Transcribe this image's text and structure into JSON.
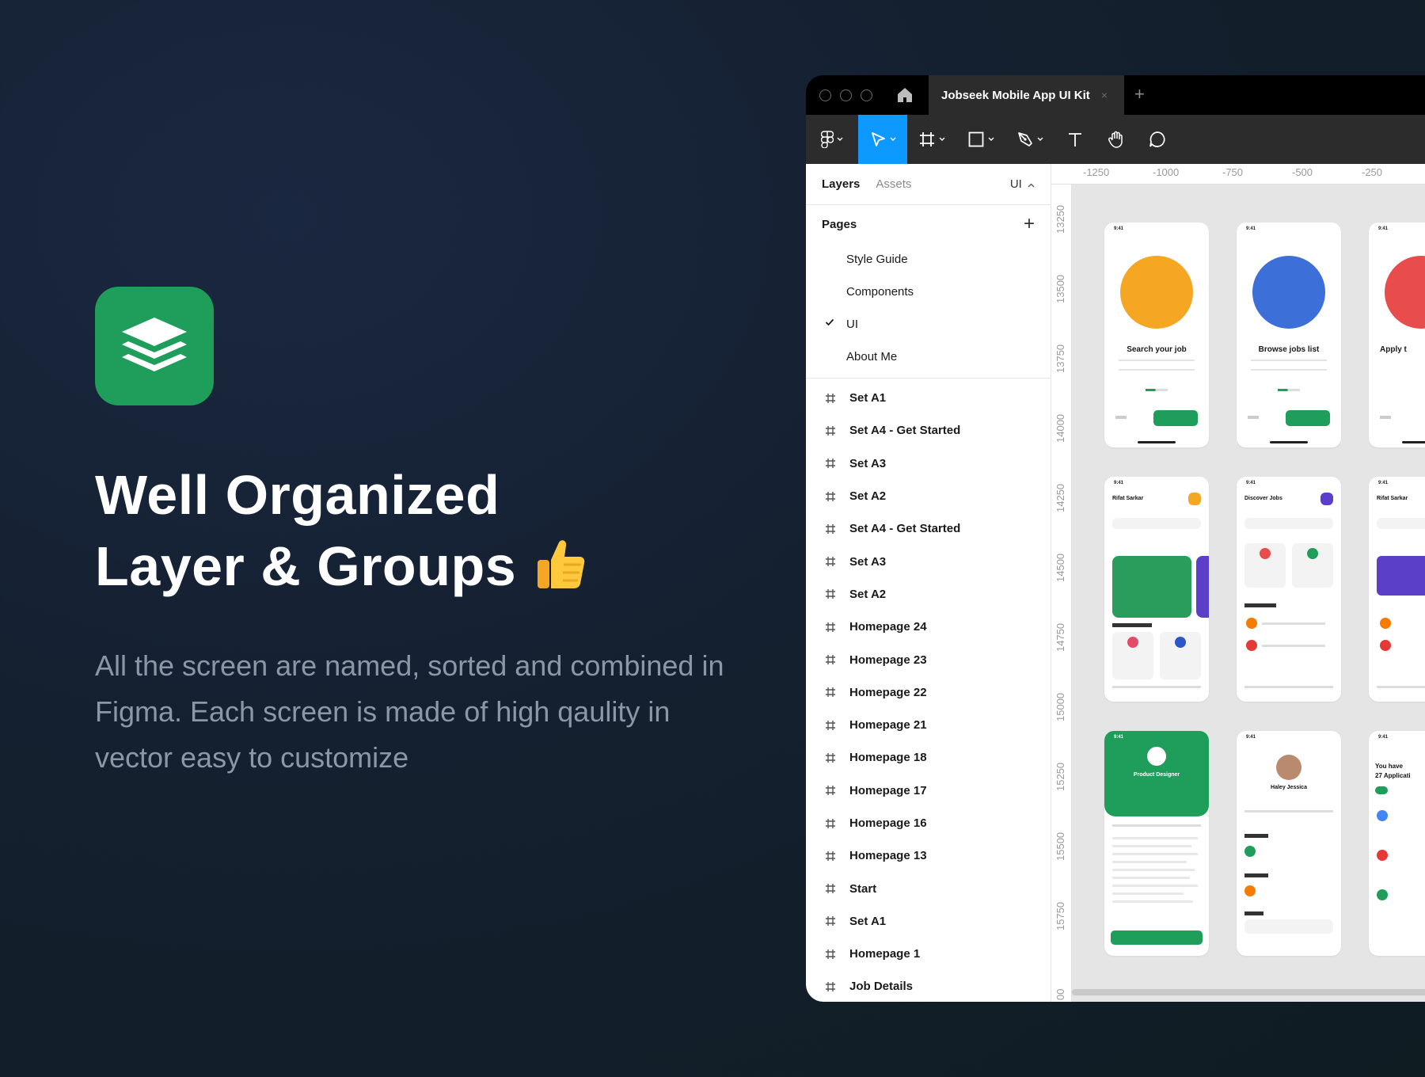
{
  "hero": {
    "title_line1": "Well Organized",
    "title_line2": "Layer & Groups",
    "description": "All the screen are named, sorted and combined in Figma. Each screen is made of high qaulity in vector easy to customize"
  },
  "window": {
    "tab_title": "Jobseek Mobile App UI Kit",
    "tab_close": "×",
    "new_tab": "+"
  },
  "panel": {
    "tab_layers": "Layers",
    "tab_assets": "Assets",
    "current_page": "UI",
    "pages_label": "Pages",
    "add": "+",
    "pages": [
      {
        "label": "Style Guide",
        "checked": false
      },
      {
        "label": "Components",
        "checked": false
      },
      {
        "label": "UI",
        "checked": true
      },
      {
        "label": "About Me",
        "checked": false
      }
    ],
    "layers": [
      "Set A1",
      "Set A4 - Get Started",
      "Set A3",
      "Set A2",
      "Set A4 - Get Started",
      "Set A3",
      "Set A2",
      "Homepage 24",
      "Homepage 23",
      "Homepage 22",
      "Homepage 21",
      "Homepage 18",
      "Homepage 17",
      "Homepage 16",
      "Homepage 13",
      "Start",
      "Set A1",
      "Homepage 1",
      "Job Details"
    ]
  },
  "ruler": {
    "top": [
      "-1250",
      "-1000",
      "-750",
      "-500",
      "-250"
    ],
    "left": [
      "13250",
      "13500",
      "13750",
      "14000",
      "14250",
      "14500",
      "14750",
      "15000",
      "15250",
      "15500",
      "15750",
      "00"
    ]
  },
  "screens": {
    "onboard1_title": "Search your job",
    "onboard2_title": "Browse jobs list",
    "onboard3_title": "Apply t",
    "home1_name": "Rifat Sarkar",
    "home2_title": "Discover Jobs",
    "home3_name": "Rifat Sarkar",
    "detail_role": "Product Designer",
    "profile_name": "Haley Jessica",
    "apps_title1": "You have",
    "apps_title2": "27 Applicati",
    "status_time": "9:41"
  },
  "colors": {
    "brand_green": "#1e9e5a",
    "figma_blue": "#0d99ff",
    "purple": "#5b3fc9"
  },
  "icons": {
    "app": "stack-layers-icon",
    "thumbs": "thumbs-up-icon",
    "frame": "hash-frame-icon"
  }
}
